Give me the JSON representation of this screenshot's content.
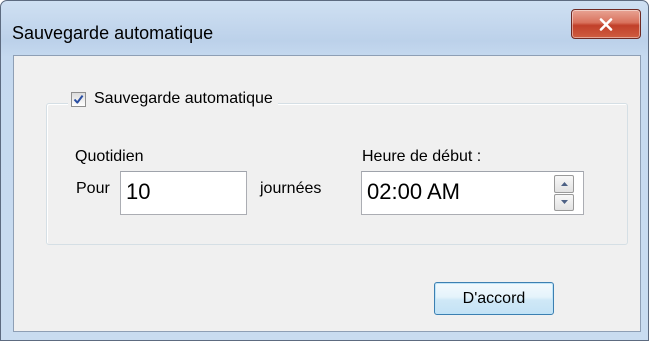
{
  "window": {
    "title": "Sauvegarde automatique"
  },
  "icons": {
    "close": "close-icon",
    "checkmark": "checkmark-icon",
    "spin_up": "chevron-up-icon",
    "spin_down": "chevron-down-icon"
  },
  "group": {
    "checkbox_label": "Sauvegarde automatique",
    "checked": true
  },
  "schedule": {
    "frequency_label": "Quotidien",
    "every_label": "Pour",
    "days_value": "10",
    "days_unit": "journées",
    "start_time_label": "Heure de début :",
    "start_time_value": "02:00 AM"
  },
  "buttons": {
    "ok_label": "D'accord"
  },
  "colors": {
    "close_button": "#c1402a",
    "accent_border": "#3c7fb1",
    "frame": "#c5d9ef"
  }
}
